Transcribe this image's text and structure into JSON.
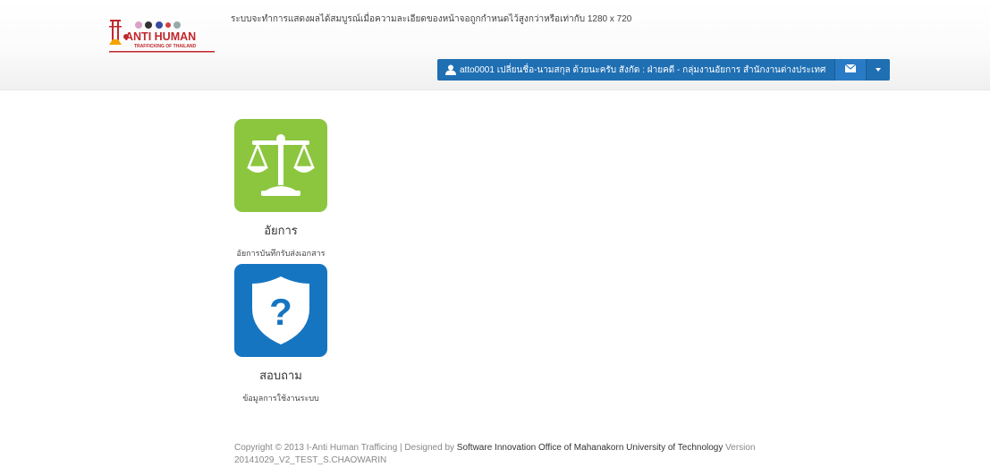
{
  "header": {
    "logo_text": "ANTI HUMAN",
    "logo_subtext": "TRAFFICKING OF THAILAND",
    "resolution_notice": "ระบบจะทำการแสดงผลได้สมบูรณ์เมื่อความละเอียดของหน้าจอถูกกำหนดไว้สูงกว่าหรือเท่ากับ 1280 x 720",
    "user_label": "atto0001 เปลี่ยนชื่อ-นามสกุล ด้วยนะครับ สังกัด : ฝ่ายคดี - กลุ่มงานอัยการ สำนักงานต่างประเทศ"
  },
  "apps": [
    {
      "title": "อัยการ",
      "subtitle": "อัยการบันทึกรับส่งเอกสาร",
      "icon": "scales-icon",
      "color": "#8cc63f"
    },
    {
      "title": "สอบถาม",
      "subtitle": "ข้อมูลการใช้งานระบบ",
      "icon": "shield-question-icon",
      "color": "#1675c1"
    }
  ],
  "footer": {
    "copyright": "Copyright © 2013 I-Anti Human Trafficing | Designed by ",
    "designer": "Software Innovation Office of Mahanakorn University of Technology",
    "version_label": " Version",
    "version": "20141029_V2_TEST_S.CHAOWARIN"
  }
}
